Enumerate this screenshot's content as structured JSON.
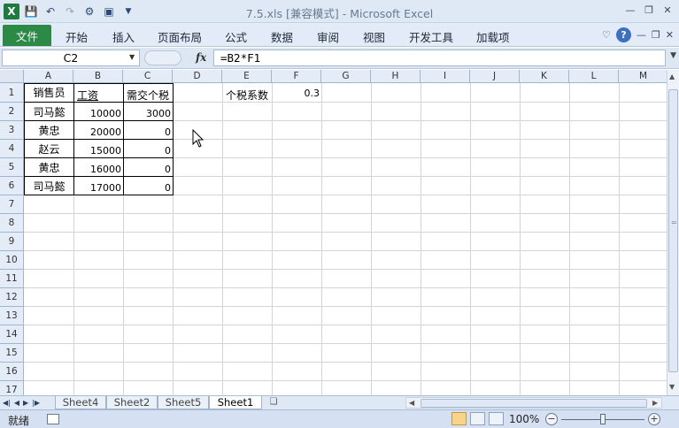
{
  "window": {
    "title": "7.5.xls  [兼容模式] - Microsoft Excel"
  },
  "ribbon": {
    "file_tab": "文件",
    "tabs": [
      "开始",
      "插入",
      "页面布局",
      "公式",
      "数据",
      "审阅",
      "视图",
      "开发工具",
      "加载项"
    ]
  },
  "formula_bar": {
    "name_box": "C2",
    "fx": "fx",
    "formula": "=B2*F1"
  },
  "grid": {
    "columns": [
      "A",
      "B",
      "C",
      "D",
      "E",
      "F",
      "G",
      "H",
      "I",
      "J",
      "K",
      "L",
      "M"
    ],
    "rows": [
      "1",
      "2",
      "3",
      "4",
      "5",
      "6",
      "7",
      "8",
      "9",
      "10",
      "11",
      "12",
      "13",
      "14",
      "15",
      "16",
      "17"
    ],
    "cells": {
      "A1": "销售员",
      "B1": "工资",
      "C1": "需交个税",
      "A2": "司马懿",
      "B2": "10000",
      "C2": "3000",
      "A3": "黄忠",
      "B3": "20000",
      "C3": "0",
      "A4": "赵云",
      "B4": "15000",
      "C4": "0",
      "A5": "黄忠",
      "B5": "16000",
      "C5": "0",
      "A6": "司马懿",
      "B6": "17000",
      "C6": "0",
      "E1": "个税系数",
      "F1": "0.3"
    }
  },
  "sheets": {
    "tabs": [
      "Sheet4",
      "Sheet2",
      "Sheet5",
      "Sheet1"
    ],
    "active": "Sheet1"
  },
  "status": {
    "ready": "就绪",
    "zoom": "100%"
  },
  "icons": {
    "excel_logo": "X",
    "help": "?"
  }
}
